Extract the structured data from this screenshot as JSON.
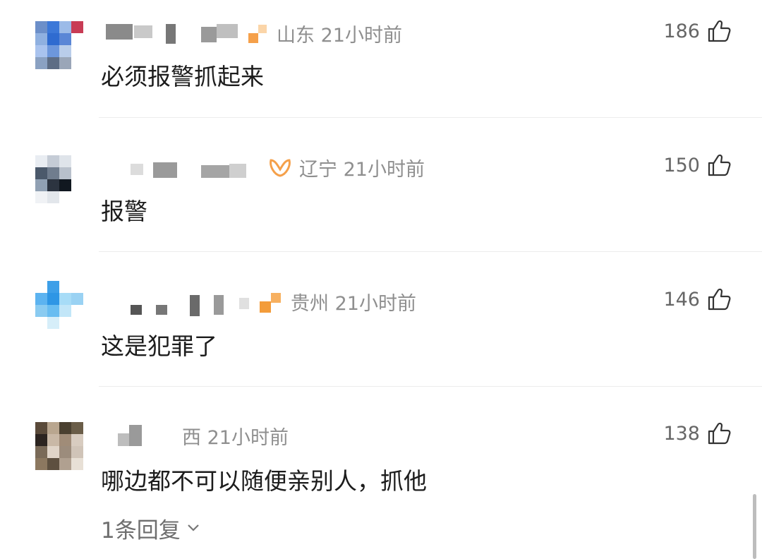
{
  "comments": [
    {
      "location_time": "山东 21小时前",
      "likes": "186",
      "text": "必须报警抓起来",
      "avatar_colors": [
        "#6c8fc9",
        "#3c78d8",
        "#9cbbe8",
        "#c83c55",
        "#8fb0e0",
        "#2f6bd0",
        "#5a86d6",
        "#ffffff",
        "#a9c3ee",
        "#6d97dc",
        "#b9cdea",
        "#ffffff",
        "#8aa1c2",
        "#5d6d85",
        "#9aa6b8",
        "#ffffff"
      ]
    },
    {
      "location_time": "辽宁 21小时前",
      "likes": "150",
      "text": "报警",
      "avatar_colors": [
        "#e9edf2",
        "#c5ccd6",
        "#dfe4ea",
        "#ffffff",
        "#4b596b",
        "#707d8e",
        "#b8c0cb",
        "#ffffff",
        "#90a0b3",
        "#2c3440",
        "#111820",
        "#ffffff",
        "#f0f2f5",
        "#e2e6eb",
        "#ffffff",
        "#ffffff"
      ]
    },
    {
      "location_time": "贵州 21小时前",
      "likes": "146",
      "text": "这是犯罪了",
      "avatar_colors": [
        "#ffffff",
        "#3d9fe8",
        "#ffffff",
        "#ffffff",
        "#5cb3f0",
        "#2e96e5",
        "#a7dcf7",
        "#9ad2f3",
        "#8acbf1",
        "#69bdf1",
        "#c2e6f8",
        "#ffffff",
        "#ffffff",
        "#d6eef9",
        "#ffffff",
        "#ffffff"
      ]
    },
    {
      "location_time": "西 21小时前",
      "likes": "138",
      "text": "哪边都不可以随便亲别人，抓他",
      "replies_label": "1条回复",
      "avatar_colors": [
        "#5a4a3a",
        "#b9a68f",
        "#4a4030",
        "#6a5d48",
        "#2c2420",
        "#c9b8a6",
        "#a08c78",
        "#d8ccc0",
        "#7a6a58",
        "#e0d4c8",
        "#9c8c7c",
        "#d0c4b8",
        "#8c7860",
        "#5e5040",
        "#b0a090",
        "#e8e0d6"
      ]
    }
  ],
  "colors": {
    "text": "#1c1c1c",
    "meta": "#8f8f8f",
    "badge": "#f5a04a",
    "divider": "#ececec"
  },
  "icons": {
    "like": "thumbs-up-icon",
    "chevron": "chevron-down-icon"
  }
}
